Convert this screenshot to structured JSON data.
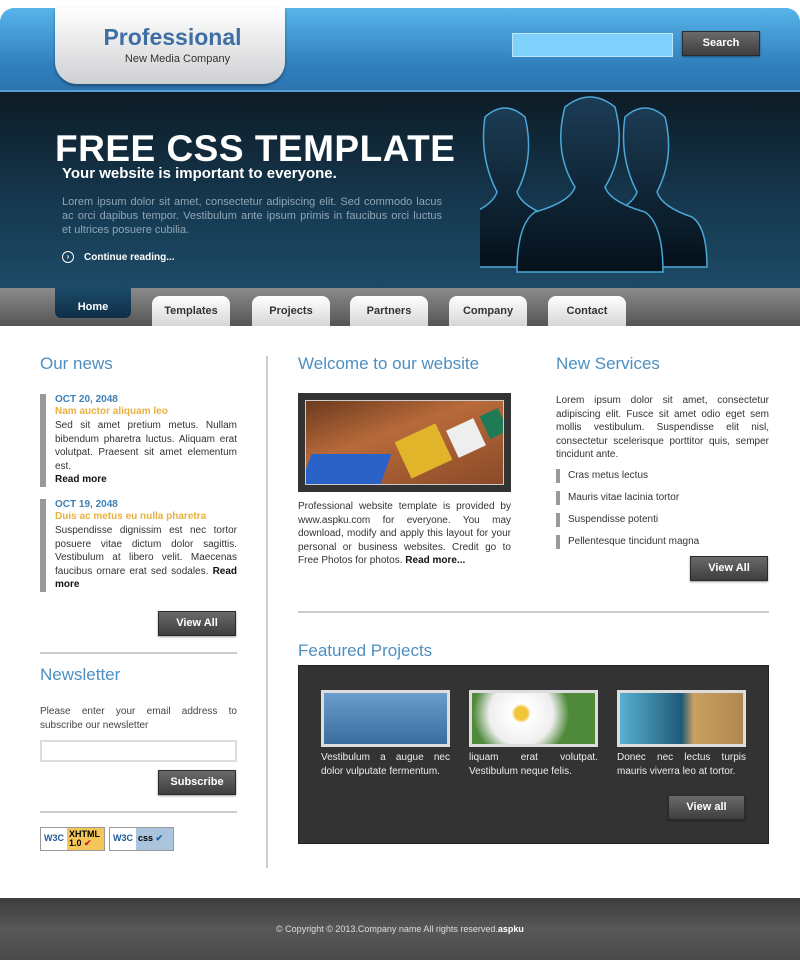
{
  "header": {
    "logo_title": "Professional",
    "logo_subtitle": "New Media Company",
    "search_placeholder": "",
    "search_button": "Search"
  },
  "hero": {
    "title": "FREE CSS TEMPLATE",
    "subtitle": "Your website is important to everyone.",
    "body": "Lorem ipsum dolor sit amet, consectetur adipiscing elit. Sed commodo lacus ac orci dapibus tempor. Vestibulum ante ipsum primis in faucibus orci luctus et ultrices posuere cubilia.",
    "continue": "Continue reading..."
  },
  "nav": {
    "items": [
      "Home",
      "Templates",
      "Projects",
      "Partners",
      "Company",
      "Contact"
    ],
    "active": "Home"
  },
  "news": {
    "title": "Our news",
    "items": [
      {
        "date": "OCT 20, 2048",
        "headline": "Nam auctor aliquam leo",
        "body": "Sed sit amet pretium metus. Nullam bibendum pharetra luctus. Aliquam erat volutpat. Praesent sit amet elementum est.",
        "more": "Read more"
      },
      {
        "date": "OCT 19, 2048",
        "headline": "Duis ac metus eu nulla pharetra",
        "body": "Suspendisse dignissim est nec tortor posuere vitae dictum dolor sagittis. Vestibulum at libero velit. Maecenas faucibus ornare erat sed sodales.",
        "more": "Read more"
      }
    ],
    "view_all": "View All"
  },
  "newsletter": {
    "title": "Newsletter",
    "text": "Please enter your email address to subscribe our newsletter",
    "email_value": "",
    "subscribe": "Subscribe"
  },
  "badges": {
    "xhtml": "W3C XHTML 1.0",
    "css": "W3C CSS"
  },
  "welcome": {
    "title": "Welcome to our website",
    "body": "Professional website template is provided by www.aspku.com for everyone. You may download, modify and apply this layout for your personal or business websites. Credit go to Free Photos for photos.",
    "more": "Read more..."
  },
  "services": {
    "title": "New Services",
    "body": "Lorem ipsum dolor sit amet, consectetur adipiscing elit. Fusce sit amet odio eget sem mollis vestibulum. Suspendisse elit nisl, consectetur scelerisque porttitor quis, semper tincidunt ante.",
    "items": [
      "Cras metus lectus",
      "Mauris vitae lacinia tortor",
      "Suspendisse potenti",
      "Pellentesque tincidunt magna"
    ],
    "view_all": "View All"
  },
  "featured": {
    "title": "Featured Projects",
    "items": [
      {
        "caption": "Vestibulum a augue nec dolor vulputate fermentum."
      },
      {
        "caption": "liquam erat volutpat. Vestibulum neque felis."
      },
      {
        "caption": "Donec nec lectus turpis mauris viverra leo at tortor."
      }
    ],
    "view_all": "View all"
  },
  "footer": {
    "text": "© Copyright © 2013.Company name All rights reserved.",
    "brand": "aspku"
  },
  "colors": {
    "accent": "#4d8fc0",
    "date": "#3d7fb5",
    "headline": "#e8b040",
    "header_blue": "#2f7fbd"
  }
}
